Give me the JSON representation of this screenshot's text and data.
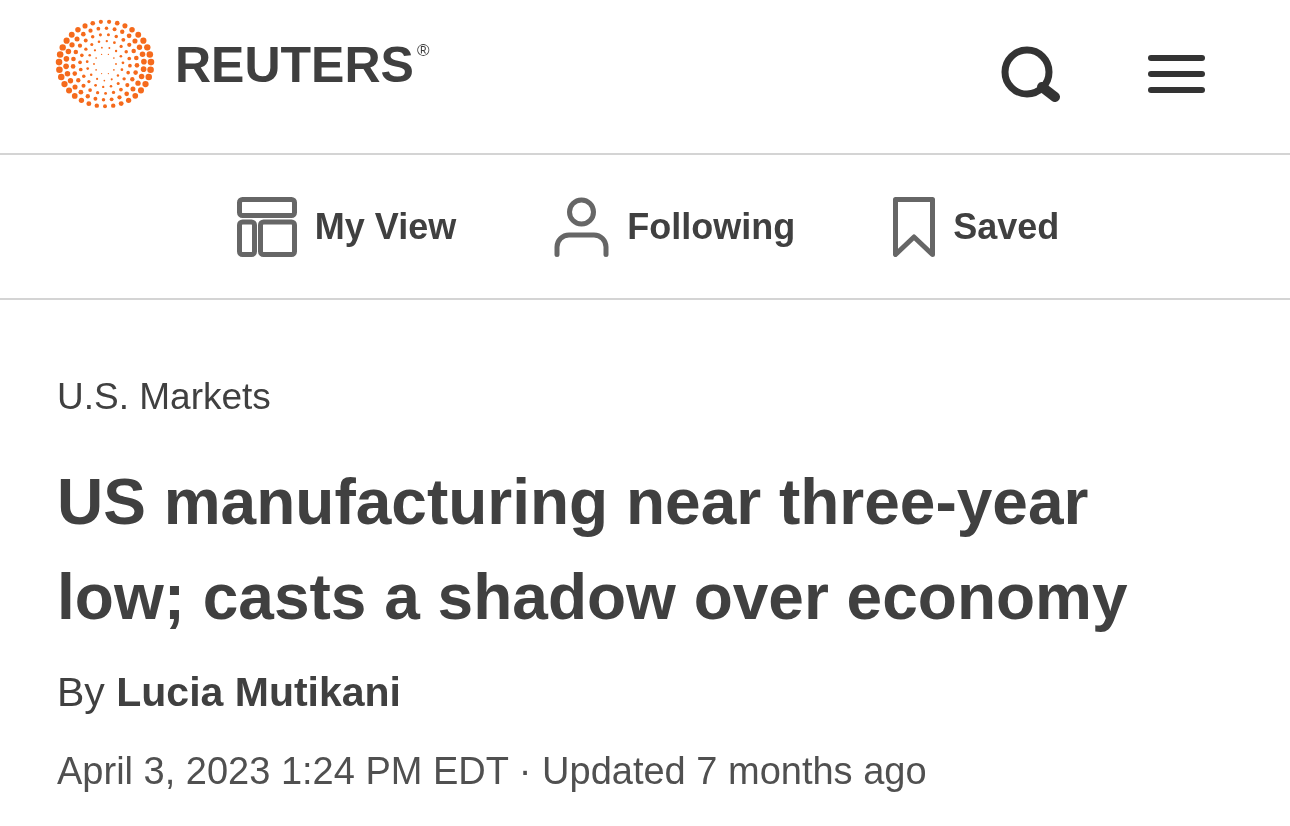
{
  "header": {
    "logo_text": "REUTERS$^{®}$"
  },
  "nav": [
    {
      "label": "My View",
      "kind": "layout"
    },
    {
      "label": "Following",
      "kind": "person"
    },
    {
      "label": "Saved",
      "kind": "bookmark"
    }
  ],
  "article": {
    "section": "U.S. Markets",
    "headline": "US manufacturing near three-year low; casts a shadow over economy",
    "byline": "By **Lucia Mutikani**",
    "dateline": "April 3, 2023 1:24 PM EDT · Updated 7 months ago"
  }
}
